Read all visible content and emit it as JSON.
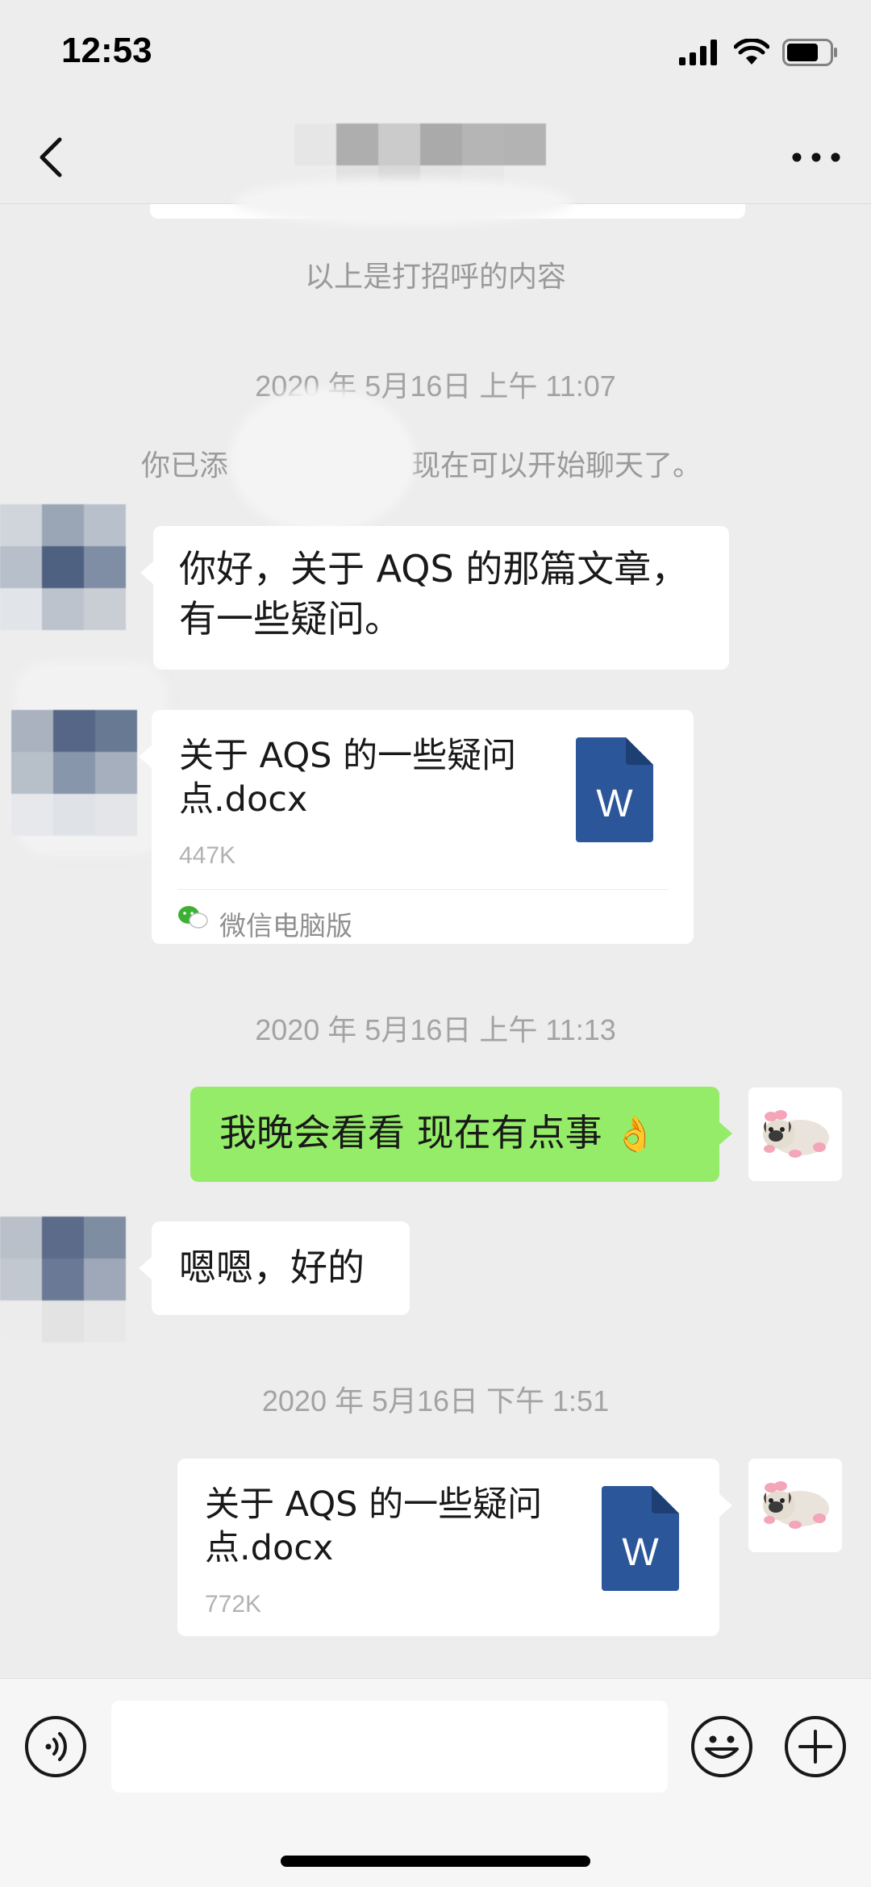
{
  "status_bar": {
    "time": "12:53"
  },
  "nav": {
    "back_icon": "chevron-left-icon",
    "more_icon": "ellipsis-icon"
  },
  "messages": {
    "greeting_note": "以上是打招呼的内容",
    "ts1": "2020 年 5月16日 上午 11:07",
    "added_notice_left": "你已添",
    "added_notice_right": "现在可以开始聊天了。",
    "text1": "你好，关于 AQS 的那篇文章，有一些疑问。",
    "file1": {
      "name": "关于 AQS 的一些疑问点.docx",
      "size": "447K",
      "icon_letter": "W",
      "source": "微信电脑版"
    },
    "ts2": "2020 年 5月16日 上午 11:13",
    "text2": "我晚会看看  现在有点事",
    "text2_emoji": "👌",
    "text3": "嗯嗯，好的",
    "ts3": "2020 年 5月16日 下午 1:51",
    "file2": {
      "name": "关于 AQS 的一些疑问点.docx",
      "size": "772K",
      "icon_letter": "W"
    }
  },
  "colors": {
    "bubble_green": "#95ec69",
    "word_blue": "#2b579a",
    "background": "#ededed"
  }
}
